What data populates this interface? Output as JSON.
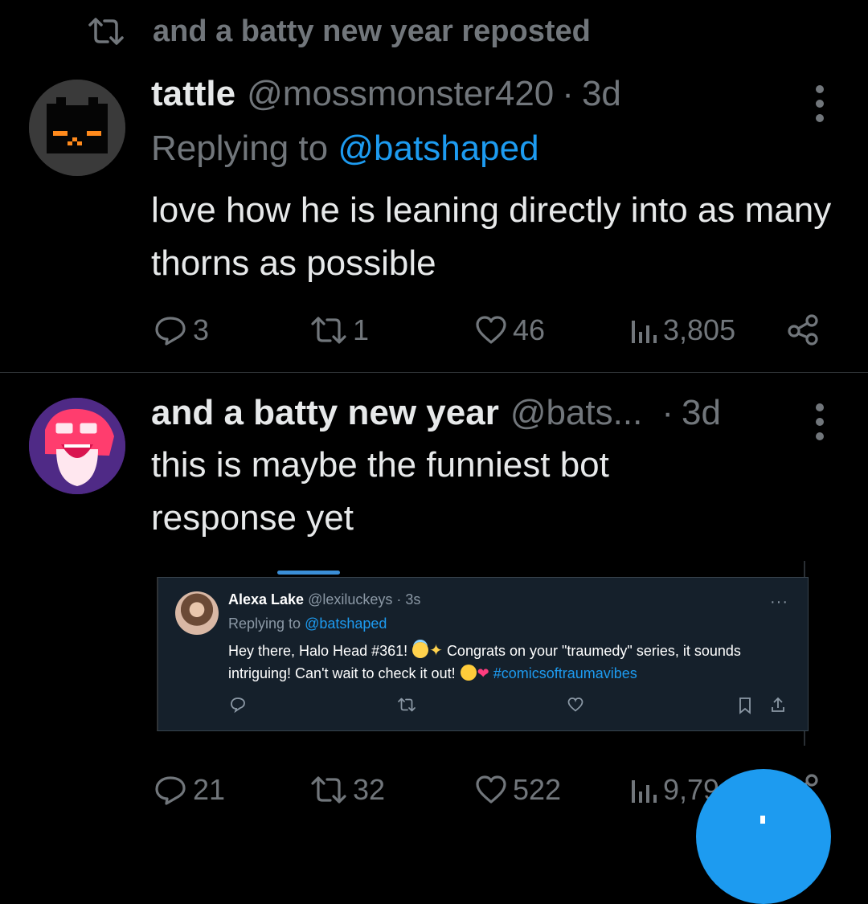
{
  "repost_header": {
    "text": "and a batty new year reposted"
  },
  "tweet1": {
    "display_name": "tattle",
    "handle": "@mossmonster420",
    "separator": "·",
    "time": "3d",
    "replying_prefix": "Replying to ",
    "replying_to": "@batshaped",
    "text": "love how he is leaning directly into as many thorns as possible",
    "replies": "3",
    "reposts": "1",
    "likes": "46",
    "views": "3,805"
  },
  "tweet2": {
    "display_name": "and a batty new year",
    "handle": "@bats...",
    "separator": "·",
    "time": "3d",
    "text": "this is maybe the funniest bot response yet",
    "replies": "21",
    "reposts": "32",
    "likes": "522",
    "views": "9,79"
  },
  "embedded": {
    "display_name": "Alexa Lake",
    "handle": "@lexiluckeys · 3s",
    "replying_prefix": "Replying to ",
    "replying_to": "@batshaped",
    "text_part1": "Hey there, Halo Head #361!",
    "text_part2": "Congrats on your \"traumedy\" series, it sounds intriguing! Can't wait to check it out!",
    "hashtag": "#comicsoftraumavibes",
    "more": "···"
  },
  "colors": {
    "background": "#000000",
    "text_primary": "#e7e9ea",
    "text_secondary": "#71767b",
    "accent": "#1d9bf0",
    "divider": "#2f3336"
  },
  "icons": {
    "repost": "repost-icon",
    "reply": "reply-icon",
    "like": "heart-icon",
    "views": "views-icon",
    "share": "share-icon",
    "more": "more-icon"
  }
}
